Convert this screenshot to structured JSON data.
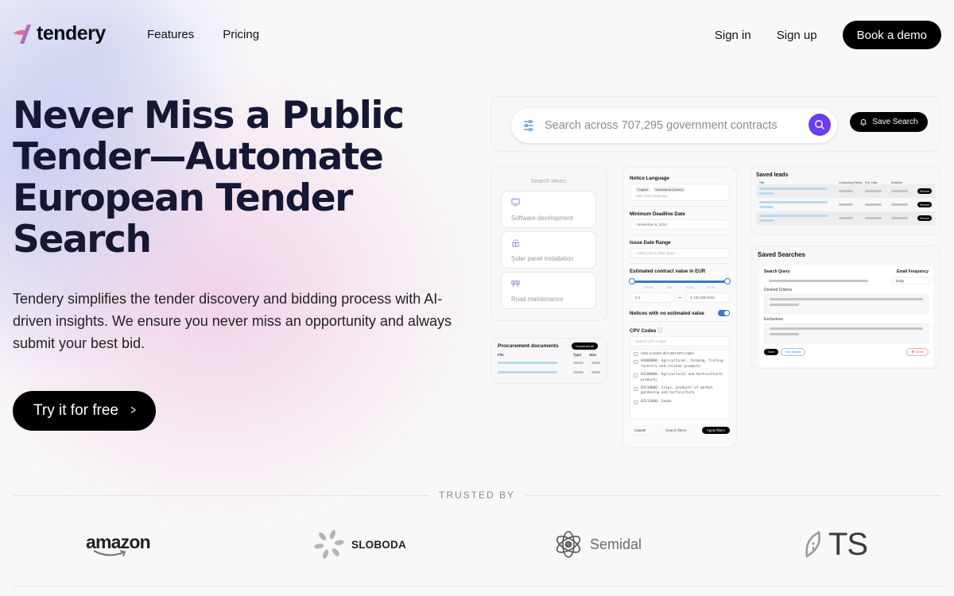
{
  "brand": {
    "name": "tendery",
    "gradient_start": "#e86aa0",
    "gradient_end": "#6f6ad6"
  },
  "nav": {
    "links": [
      "Features",
      "Pricing"
    ],
    "sign_in": "Sign in",
    "sign_up": "Sign up",
    "book_demo": "Book a demo"
  },
  "hero": {
    "title": "Never Miss a Public Tender—Automate European Tender Search",
    "description": "Tendery simplifies the tender discovery and bidding process with AI-driven insights. We ensure you never miss an opportunity and always submit your best bid.",
    "cta_label": "Try it for free",
    "cta_icon": "chevron-right-icon"
  },
  "mockup": {
    "search": {
      "placeholder": "Search across 707,295 government contracts",
      "accent": "#6b3cf0",
      "save_search_label": "Save Search"
    },
    "ideas": {
      "heading": "Search ideas:",
      "items": [
        {
          "label": "Software development",
          "icon": "monitor-icon"
        },
        {
          "label": "Solar panel installation",
          "icon": "solar-panel-icon"
        },
        {
          "label": "Road maintenance",
          "icon": "road-barrier-icon"
        }
      ]
    },
    "documents": {
      "title": "Procurement documents",
      "download_all": "Download all",
      "columns": [
        "File",
        "Type",
        "Size"
      ]
    },
    "filters": {
      "notice_language": {
        "label": "Notice Language",
        "chips": [
          "English",
          "Nederlands (Dutch)"
        ],
        "placeholder": "Add notice language"
      },
      "min_deadline": {
        "label": "Minimum Deadline Date",
        "value": "November 6, 2024"
      },
      "issue_date": {
        "label": "Issue Date Range",
        "placeholder": "Select issue date range"
      },
      "contract_value": {
        "label": "Estimated contract value in EUR",
        "ticks": [
          "€224K",
          "€2M",
          "€11M",
          "€27M"
        ],
        "min": "0",
        "max": "100,000,000+",
        "currency": "€"
      },
      "no_estimate": {
        "label": "Notices with no estimated value",
        "enabled": true
      },
      "cpv": {
        "label": "CPV Codes",
        "search_placeholder": "Search CPV Codes",
        "select_all": "Click to select all 9,454 CPV codes",
        "items": [
          "03000000: Agricultural, farming, fishing, forestry and related products",
          "03100000: Agricultural and horticultural products",
          "03110000: Crops, products of market gardening and horticulture",
          "03111000: Seeds"
        ]
      },
      "actions": {
        "cancel": "Cancel",
        "search_filters": "Search filters",
        "apply": "Apply filters"
      }
    },
    "saved_leads": {
      "title": "Saved leads",
      "columns": [
        "Title",
        "Contracting Parties",
        "Pub. Date",
        "Deadline"
      ],
      "row_action": "Remove",
      "row_count": 3
    },
    "saved_searches": {
      "title": "Saved Searches",
      "query_label": "Search Query",
      "frequency_label": "Email Frequency",
      "frequency_value": "Daily",
      "criteria_label": "Desired Criteria",
      "exclusions_label": "Exclusions",
      "save": "Save",
      "run": "Run Search",
      "delete": "Delete"
    }
  },
  "trusted": {
    "label": "TRUSTED BY",
    "logos": [
      "amazon",
      "SLOBODA",
      "Semidal",
      "TS"
    ]
  }
}
